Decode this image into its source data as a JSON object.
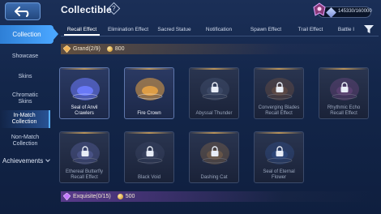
{
  "header": {
    "title": "Collectible",
    "help_glyph": "?",
    "progress_value": "145330/160000"
  },
  "sidebar": {
    "section_main": "Collection",
    "items": [
      {
        "label": "Showcase"
      },
      {
        "label": "Skins"
      },
      {
        "label": "Chromatic Skins"
      },
      {
        "label": "In-Match Collection"
      },
      {
        "label": "Non-Match Collection"
      }
    ],
    "section_bottom": "Achievements"
  },
  "tabs": [
    {
      "label": "Recall Effect"
    },
    {
      "label": "Elimination Effect"
    },
    {
      "label": "Sacred Statue"
    },
    {
      "label": "Notification"
    },
    {
      "label": "Spawn Effect"
    },
    {
      "label": "Trail Effect"
    },
    {
      "label": "Battle I"
    }
  ],
  "grand": {
    "label": "Grand(2/9)",
    "points": "800",
    "cards": [
      {
        "name": "Seal of Anvil Crawlers",
        "owned": true,
        "color": "#6d7cff"
      },
      {
        "name": "Fire Crown",
        "owned": true,
        "color": "#e6a246"
      },
      {
        "name": "Abyssal Thunder",
        "owned": false,
        "color": "#5d6d8f"
      },
      {
        "name": "Converging Blades Recall Effect",
        "owned": false,
        "color": "#a36a44"
      },
      {
        "name": "Rhythmic Echo Recall Effect",
        "owned": false,
        "color": "#a05aa8"
      },
      {
        "name": "Ethereal Butterfly Recall Effect",
        "owned": false,
        "color": "#7b83d8"
      },
      {
        "name": "Black Void",
        "owned": false,
        "color": "#4c587a"
      },
      {
        "name": "Dashing Cat",
        "owned": false,
        "color": "#c08a4a"
      },
      {
        "name": "Seal of Eternal Flower",
        "owned": false,
        "color": "#3a66b8"
      }
    ]
  },
  "exquisite": {
    "label": "Exquisite(0/15)",
    "points": "500"
  }
}
